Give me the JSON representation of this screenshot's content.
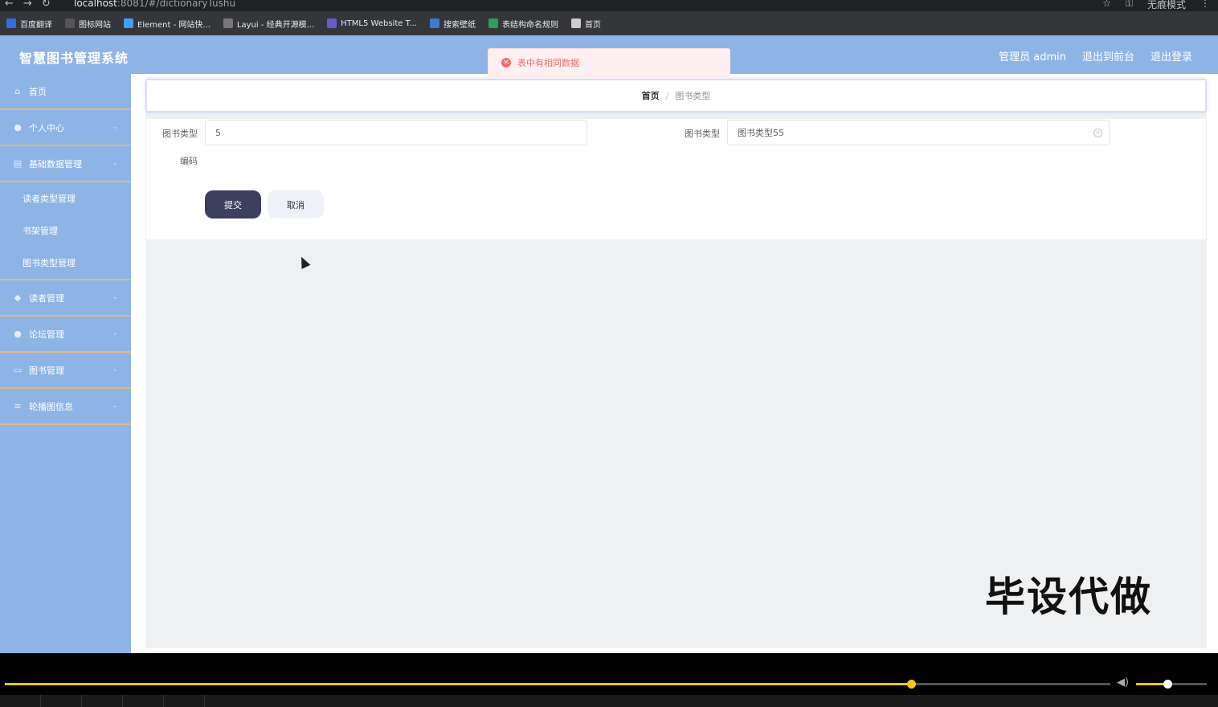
{
  "browser": {
    "url_host": "localhost",
    "url_path": ":8081/#/dictionaryTushu",
    "incognito_label": "无痕模式",
    "bookmarks": [
      {
        "label": "百度翻译",
        "color": "#2f6fe0"
      },
      {
        "label": "图标网站",
        "color": "#555555"
      },
      {
        "label": "Element - 网站快...",
        "color": "#409eff"
      },
      {
        "label": "Layui - 经典开源模...",
        "color": "#777777"
      },
      {
        "label": "HTML5 Website T...",
        "color": "#6a5acd"
      },
      {
        "label": "搜索壁纸",
        "color": "#3b7bd4"
      },
      {
        "label": "表结构命名规则",
        "color": "#2e9e5b"
      },
      {
        "label": "首页",
        "color": "#cccccc"
      }
    ]
  },
  "header": {
    "brand": "智慧图书管理系统",
    "user_label": "管理员 admin",
    "back_to_front": "退出到前台",
    "logout": "退出登录"
  },
  "toast": {
    "message": "表中有相同数据",
    "type": "error"
  },
  "sidebar": {
    "items": [
      {
        "label": "首页",
        "icon": "home-icon"
      },
      {
        "label": "个人中心",
        "icon": "user-icon"
      },
      {
        "label": "基础数据管理",
        "icon": "data-icon"
      }
    ],
    "submenu": [
      {
        "label": "读者类型管理"
      },
      {
        "label": "书架管理"
      },
      {
        "label": "图书类型管理"
      }
    ],
    "items_after": [
      {
        "label": "读者管理",
        "icon": "reader-icon"
      },
      {
        "label": "论坛管理",
        "icon": "forum-icon"
      },
      {
        "label": "图书管理",
        "icon": "book-icon"
      },
      {
        "label": "轮播图信息",
        "icon": "list-icon"
      }
    ]
  },
  "breadcrumb": {
    "home": "首页",
    "separator": "/",
    "current": "图书类型"
  },
  "form": {
    "code_label_line1": "图书类型",
    "code_label_line2": "编码",
    "code_value": "5",
    "type_label": "图书类型",
    "type_value": "图书类型55",
    "submit": "提交",
    "cancel": "取消"
  },
  "watermark": "毕设代做",
  "player": {
    "progress": 0.82,
    "volume": 0.44,
    "accent": "#f5c518"
  }
}
